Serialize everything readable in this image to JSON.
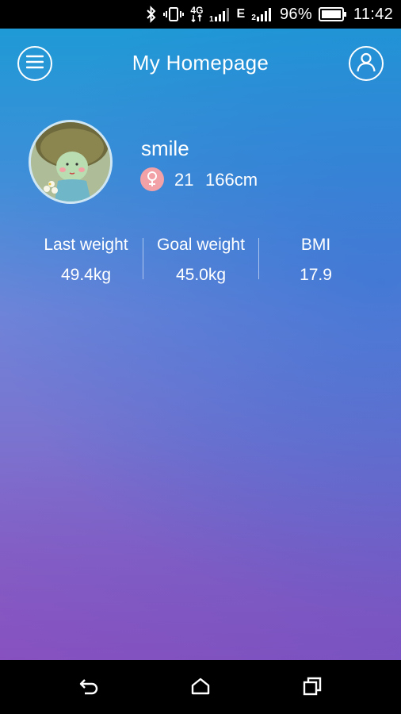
{
  "status_bar": {
    "network_4g": "4G",
    "network_e": "E",
    "sim2": "2",
    "battery_percent": "96%",
    "time": "11:42",
    "icons": [
      "bluetooth-icon",
      "vibrate-icon",
      "4g-data-icon",
      "signal-icon",
      "edge-icon",
      "signal-sim2-icon",
      "battery-icon"
    ]
  },
  "header": {
    "title": "My Homepage",
    "left_icon": "menu-icon",
    "right_icon": "user-icon"
  },
  "profile": {
    "username": "smile",
    "gender_icon": "female-icon",
    "age": "21",
    "height": "166cm"
  },
  "stats": [
    {
      "label": "Last weight",
      "value": "49.4kg"
    },
    {
      "label": "Goal weight",
      "value": "45.0kg"
    },
    {
      "label": "BMI",
      "value": "17.9"
    }
  ],
  "nav": {
    "icons": [
      "back-icon",
      "home-icon",
      "recent-apps-icon"
    ]
  },
  "colors": {
    "gradient_top": "#1f9ad6",
    "gradient_bottom": "#9a4fbd",
    "gender_badge": "#f2a1a6"
  }
}
